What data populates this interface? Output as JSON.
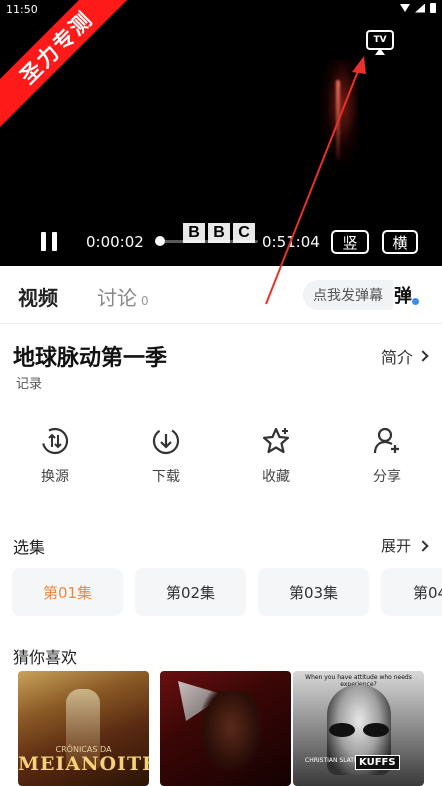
{
  "status_bar": {
    "time": "11:50"
  },
  "player": {
    "watermark": "圣力专测",
    "tv_label": "TV",
    "current_time": "0:00:02",
    "duration": "0:51:04",
    "progress_fraction": 0.001,
    "logo_letters": [
      "B",
      "B",
      "C"
    ],
    "portrait_label": "竖",
    "landscape_label": "横"
  },
  "tabs": {
    "video": "视频",
    "discuss": "讨论",
    "discuss_count": "0",
    "danmaku_placeholder": "点我发弹幕",
    "danmaku_icon_label": "弹"
  },
  "show": {
    "title": "地球脉动第一季",
    "category": "记录",
    "intro_label": "简介"
  },
  "actions": [
    {
      "name": "switch-source",
      "label": "换源",
      "icon": "switch-source-icon"
    },
    {
      "name": "download",
      "label": "下载",
      "icon": "download-icon"
    },
    {
      "name": "favorite",
      "label": "收藏",
      "icon": "star-icon"
    },
    {
      "name": "share",
      "label": "分享",
      "icon": "add-user-icon"
    }
  ],
  "episodes": {
    "heading": "选集",
    "expand_label": "展开",
    "items": [
      {
        "label": "第01集",
        "active": true
      },
      {
        "label": "第02集",
        "active": false
      },
      {
        "label": "第03集",
        "active": false
      },
      {
        "label": "第04",
        "active": false
      }
    ]
  },
  "recommend": {
    "heading": "猜你喜欢",
    "posters": [
      {
        "title": "MEIANOITE",
        "subtitle": "CRÔNICAS DA"
      },
      {
        "title": ""
      },
      {
        "title": "KUFFS",
        "tagline": "When you have attitude who needs experience?",
        "credit": "CHRISTIAN SLATER"
      }
    ]
  },
  "colors": {
    "accent": "#f0883e",
    "watermark": "#ff1a1a",
    "annotation": "#e8312a",
    "verified": "#3a8cf0"
  }
}
